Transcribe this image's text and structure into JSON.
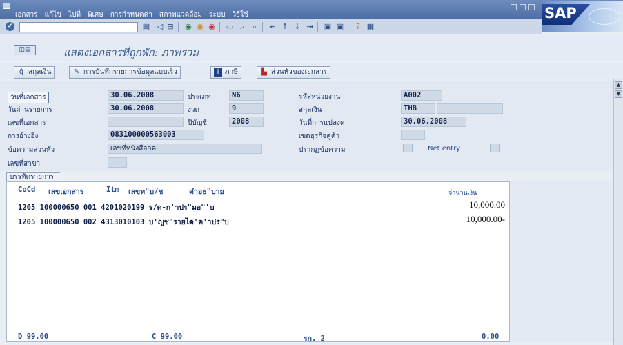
{
  "menu": {
    "items": [
      "เอกสาร",
      "แก้ไข",
      "ไปที่",
      "พิเศษ",
      "การกำหนดค่า",
      "สภาพแวดล้อม",
      "ระบบ",
      "วิธีใช้"
    ]
  },
  "logo": {
    "text": "SAP"
  },
  "toolbar": {
    "command_value": "",
    "icons": [
      "enter-icon",
      "save-icon",
      "back-icon",
      "exit-icon",
      "cancel-icon",
      "print-icon",
      "find-icon",
      "find-next-icon",
      "first-page-icon",
      "previous-page-icon",
      "next-page-icon",
      "last-page-icon",
      "create-session-icon",
      "shortcut-icon",
      "help-icon",
      "layout-icon"
    ]
  },
  "title": "แสดงเอกสารที่ถูกพัก: ภาพรวม",
  "app_toolbar": {
    "currency_label": "สกุลเงิน",
    "fast_entry_label": "การบันทึกรายการข้อมูลแบบเร็ว",
    "tax_label": "ภาษี",
    "header_label": "ส่วนหัวของเอกสาร"
  },
  "header": {
    "doc_date_label": "วันที่เอกสาร",
    "doc_date": "30.06.2008",
    "posting_date_label": "วันผ่านรายการ",
    "posting_date": "30.06.2008",
    "doc_number_label": "เลขที่เอกสาร",
    "doc_number": "",
    "reference_label": "การอ้างอิง",
    "reference": "083100000563003",
    "header_text_label": "ข้อความส่วนหัว",
    "header_text": "เลขที่หนังสือกค.",
    "branch_label": "เลขที่สาขา",
    "branch": "",
    "type_label": "ประเภท",
    "type": "N6",
    "period_label": "งวด",
    "period": "9",
    "fiscal_year_label": "ปีบัญชี",
    "fiscal_year": "2008",
    "company_code_label": "รหัสหน่วยงาน",
    "company_code": "A002",
    "currency_label": "สกุลเงิน",
    "currency": "THB",
    "currency_rate": "",
    "translation_date_label": "วันที่การแปลงค่",
    "translation_date": "30.06.2008",
    "trading_partner_label": "เขตธุรกิจคู่ค้า",
    "trading_partner": "",
    "show_text_label": "ปรากฏข้อความ",
    "net_entry_label": "Net entry"
  },
  "items": {
    "tab_label": "บรรทัดรายการ",
    "headers": {
      "cocd": "CoCd",
      "doc_no": "เลขเอกสาร",
      "itm": "Itm",
      "account": "เลขท\"บ/ช",
      "short_text": "คำอธ\"บาย",
      "amount": "จำนวนเงิน"
    },
    "rows": [
      {
        "cocd": "1205",
        "doc_no": "100000650",
        "itm": "001",
        "account": "4201020199",
        "text": "ร/ด-ก'าปร\"มอ\"'บ",
        "amount": "10,000.00"
      },
      {
        "cocd": "1205",
        "doc_no": "100000650",
        "itm": "002",
        "account": "4313010103",
        "text": "บ'ญช\"รายได'ค'าปร\"บ",
        "amount": "10,000.00-"
      }
    ],
    "footer": {
      "debit": "D 99.00",
      "credit": "C 99.00",
      "count": "รก. 2",
      "balance": "0.00"
    }
  }
}
